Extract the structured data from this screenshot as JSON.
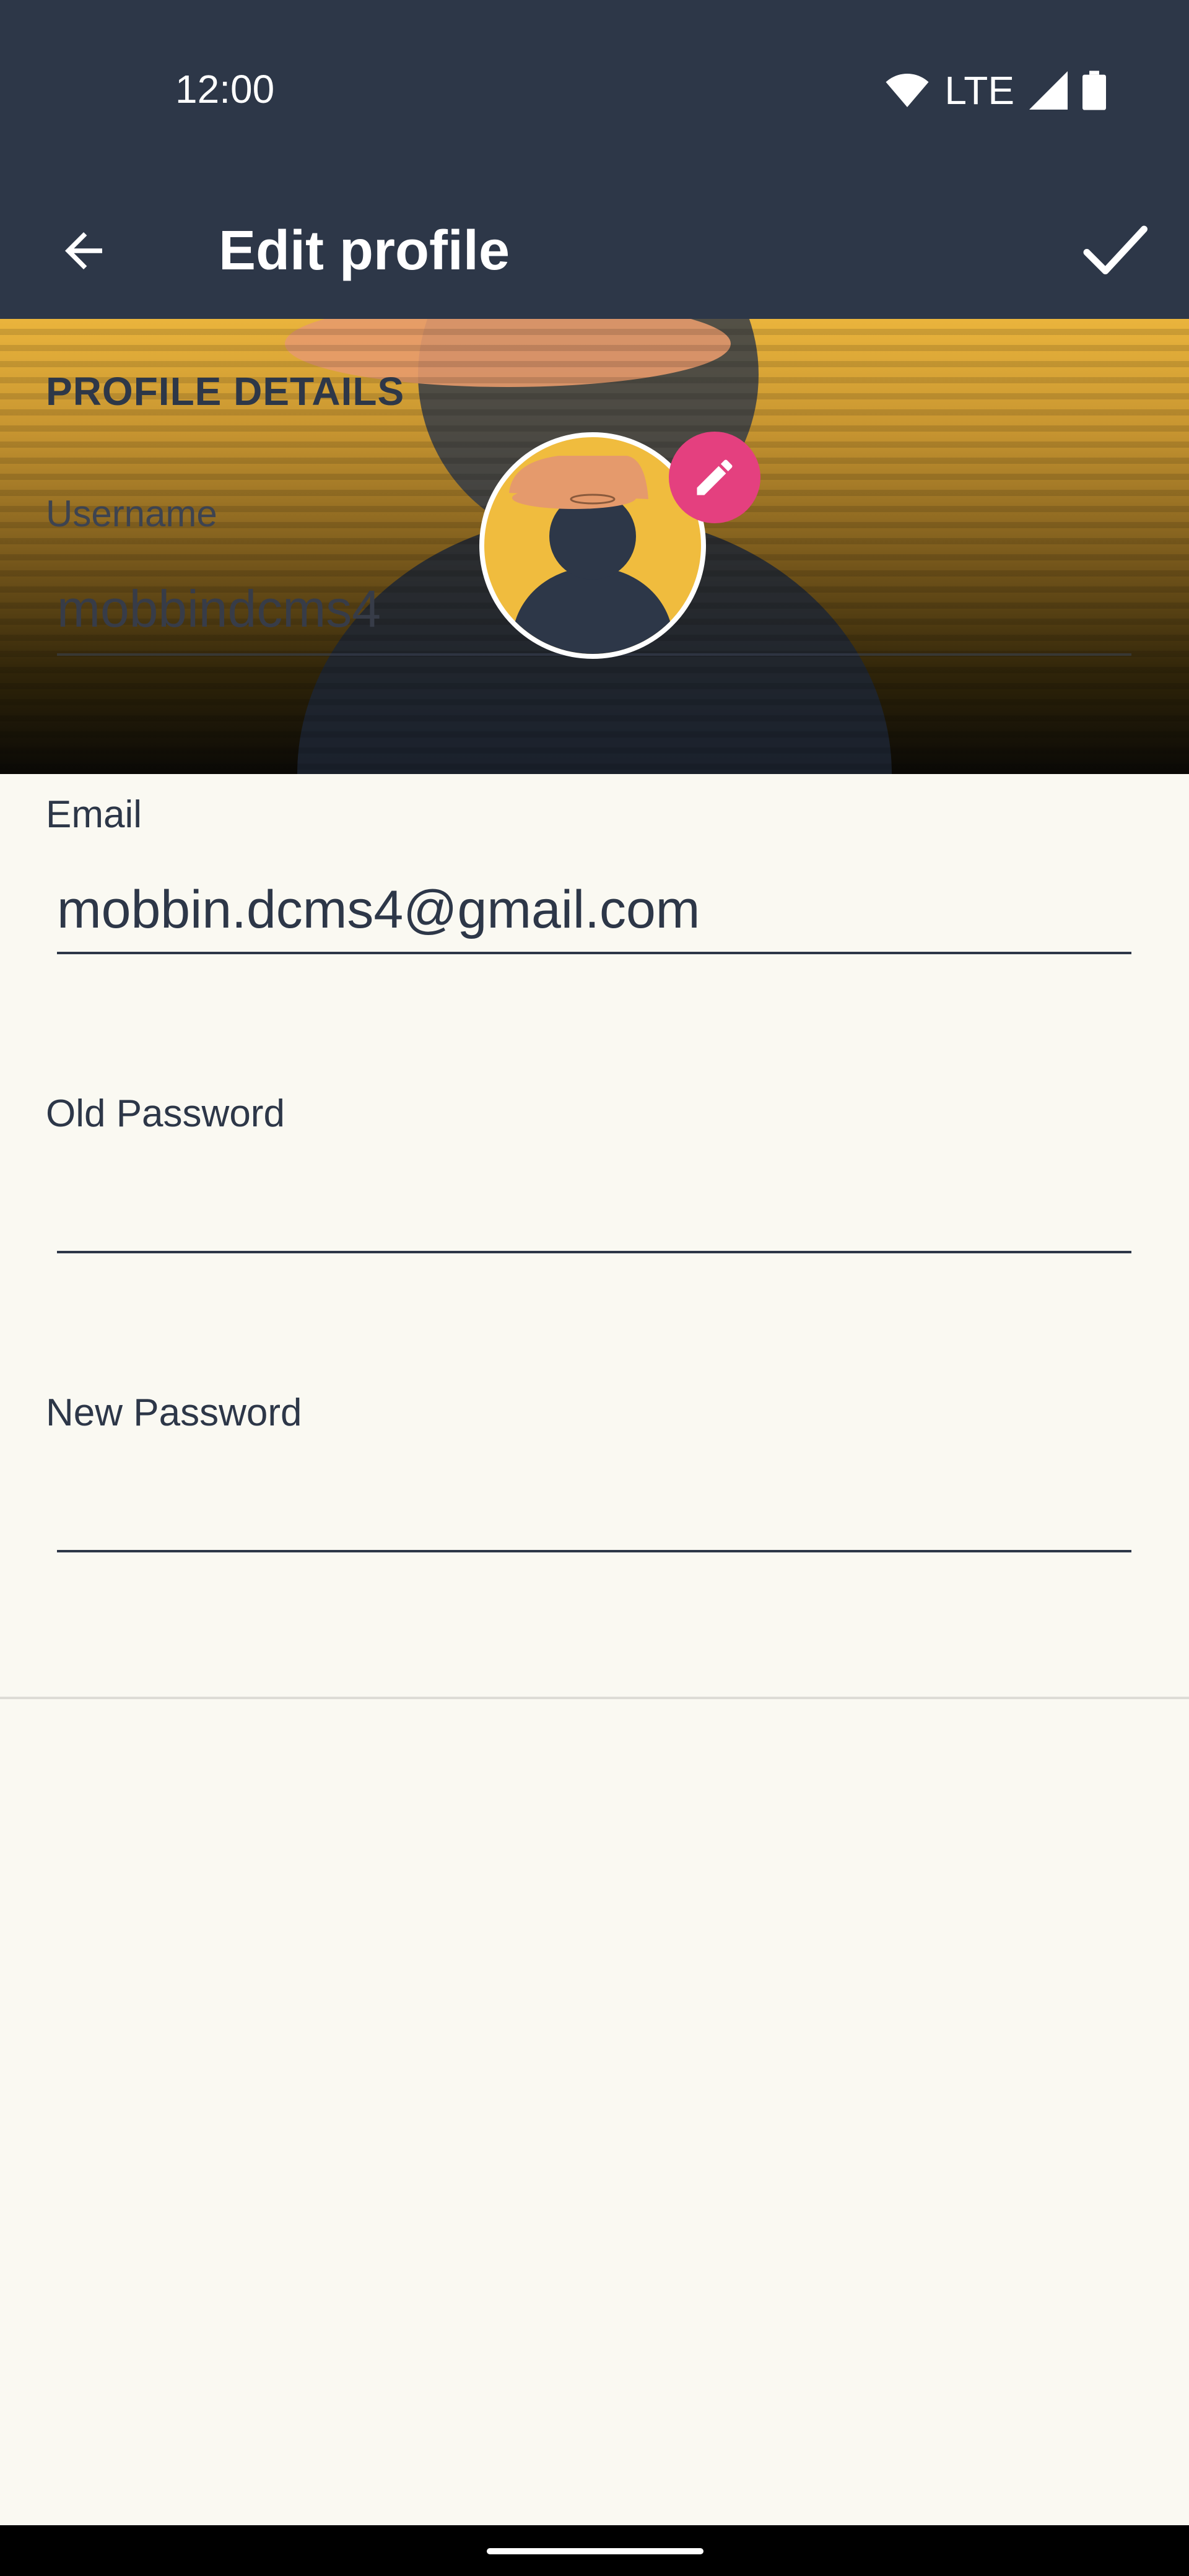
{
  "status_bar": {
    "time": "12:00",
    "network": "LTE",
    "icons": [
      "wifi-icon",
      "cell-signal-icon",
      "battery-icon"
    ]
  },
  "app_bar": {
    "title": "Edit profile",
    "back_icon": "arrow-back-icon",
    "save_icon": "check-icon"
  },
  "profile": {
    "section_title": "PROFILE DETAILS",
    "username": {
      "label": "Username",
      "value": "mobbindcms4"
    },
    "avatar_edit_icon": "pencil-icon",
    "email": {
      "label": "Email",
      "value": "mobbin.dcms4@gmail.com"
    },
    "old_password": {
      "label": "Old Password",
      "value": ""
    },
    "new_password": {
      "label": "New Password",
      "value": ""
    }
  },
  "colors": {
    "bar_bg": "#2d3748",
    "page_bg": "#faf9f2",
    "banner_yellow": "#eab43c",
    "avatar_bg": "#f0bc3e",
    "edit_button": "#e4407f",
    "text_dark": "#2d3748"
  }
}
